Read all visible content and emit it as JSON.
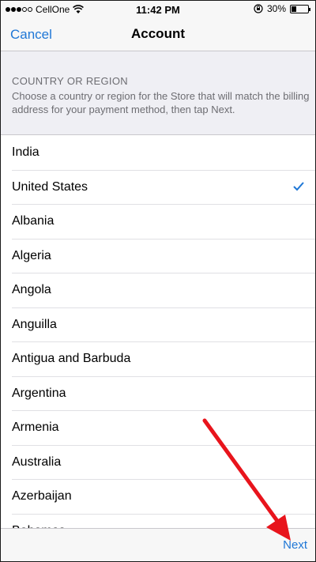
{
  "status_bar": {
    "carrier": "CellOne",
    "time": "11:42 PM",
    "battery": "30%",
    "battery_level": 0.3,
    "signal_bars_filled": 3,
    "signal_bars_total": 5
  },
  "nav": {
    "cancel_label": "Cancel",
    "title": "Account"
  },
  "section": {
    "title": "COUNTRY OR REGION",
    "description": "Choose a country or region for the Store that will match the billing address for your payment method, then tap Next."
  },
  "countries": [
    {
      "label": "India",
      "selected": false
    },
    {
      "label": "United States",
      "selected": true
    },
    {
      "label": "Albania",
      "selected": false
    },
    {
      "label": "Algeria",
      "selected": false
    },
    {
      "label": "Angola",
      "selected": false
    },
    {
      "label": "Anguilla",
      "selected": false
    },
    {
      "label": "Antigua and Barbuda",
      "selected": false
    },
    {
      "label": "Argentina",
      "selected": false
    },
    {
      "label": "Armenia",
      "selected": false
    },
    {
      "label": "Australia",
      "selected": false
    },
    {
      "label": "Azerbaijan",
      "selected": false
    },
    {
      "label": "Bahamas",
      "selected": false
    }
  ],
  "toolbar": {
    "next_label": "Next"
  },
  "colors": {
    "accent": "#1f77d6",
    "annotation_arrow": "#e8141c"
  }
}
